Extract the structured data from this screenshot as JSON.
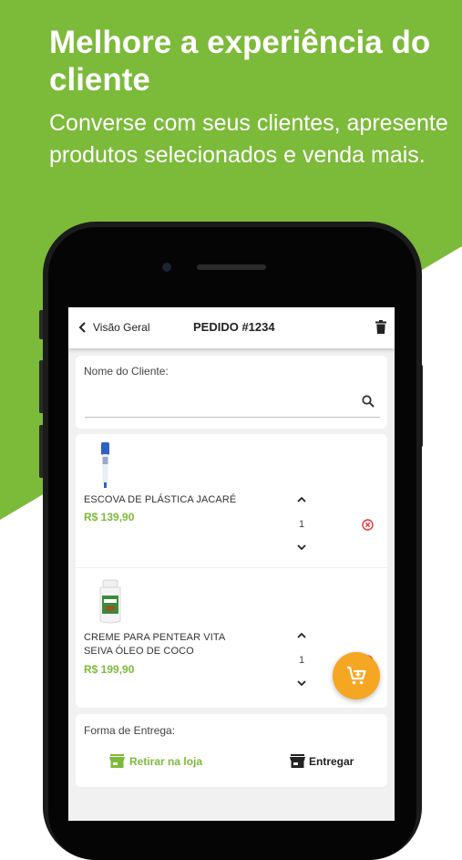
{
  "colors": {
    "brand_green": "#7cba3a",
    "fab_orange": "#f5a623",
    "remove_red": "#e53935"
  },
  "promo": {
    "headline": "Melhore a experiência do cliente",
    "subline": "Converse com seus clientes, apresente produtos selecionados e venda mais."
  },
  "appbar": {
    "back_label": "Visão Geral",
    "title": "PEDIDO #1234",
    "back_icon": "chevron-left-icon",
    "delete_icon": "trash-icon"
  },
  "customer": {
    "label": "Nome do Cliente:",
    "value": "",
    "search_icon": "search-icon"
  },
  "products": [
    {
      "name": "ESCOVA DE PLÁSTICA JACARÉ",
      "price": "R$ 139,90",
      "quantity": "1"
    },
    {
      "name": "CREME PARA PENTEAR VITA SEIVA ÓLEO DE COCO",
      "price": "R$ 199,90",
      "quantity": "1"
    }
  ],
  "delivery": {
    "label": "Forma de Entrega:",
    "options": [
      {
        "label": "Retirar na loja",
        "icon": "store-icon",
        "selected": true
      },
      {
        "label": "Entregar",
        "icon": "store-icon",
        "selected": false
      }
    ]
  },
  "fab": {
    "icon": "cart-add-icon"
  }
}
